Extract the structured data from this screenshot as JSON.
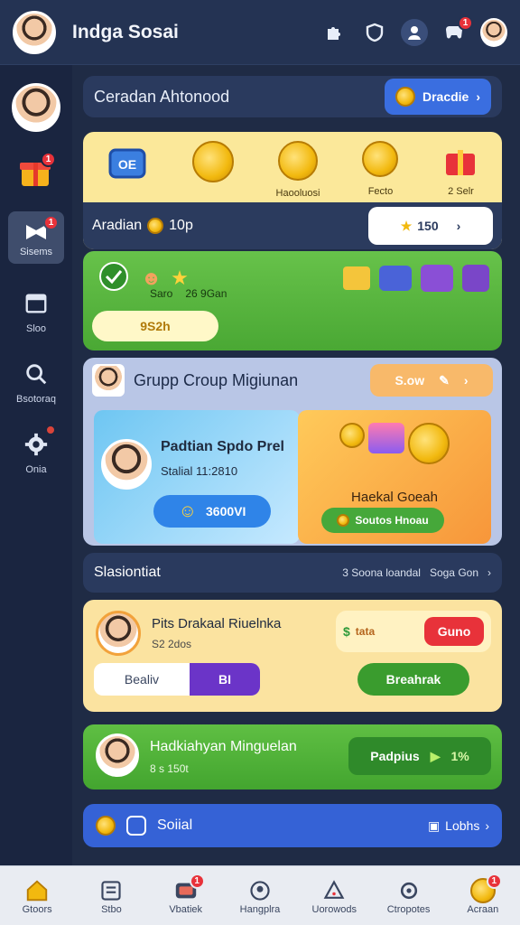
{
  "app": {
    "title": "Indga Sosai"
  },
  "topbar": {
    "notif_count": "1"
  },
  "sidebar": {
    "items": [
      {
        "label": "Sisems",
        "badge": "1"
      },
      {
        "label": "Sloo"
      },
      {
        "label": "Bsotoraq"
      },
      {
        "label": "Onia"
      }
    ]
  },
  "banner": {
    "title": "Ceradan Ahtonood",
    "button_label": "Dracdie"
  },
  "rewards": {
    "items": [
      {
        "label": ""
      },
      {
        "label": ""
      },
      {
        "label": "Haooluosi"
      },
      {
        "label": "Fecto"
      },
      {
        "label": "2 Selr"
      }
    ],
    "bottom_label": "Aradian",
    "bottom_value": "10p",
    "score": "150"
  },
  "green_card": {
    "left_a": "Saro",
    "left_b": "26 9Gan",
    "progress_label": "9S2h"
  },
  "group": {
    "title": "Grupp Croup Migiunan",
    "action_label": "S.ow",
    "promo1_title": "Padtian Spdo Prel",
    "promo1_sub": "Stalial 11:2810",
    "promo1_button": "3600VI",
    "promo2_title": "Haekal Goeah",
    "promo2_button": "Soutos Hnoau"
  },
  "section": {
    "title": "Slasiontiat",
    "right_a": "3 Soona loandal",
    "right_b": "Soga Gon"
  },
  "match": {
    "name": "Pits Drakaal Riuelnka",
    "sub": "S2 2dos",
    "chip_a": "tata",
    "chip_b": "Guno",
    "toggle_left": "Bealiv",
    "toggle_right": "BI",
    "action": "Breahrak"
  },
  "green_card2": {
    "title": "Hadkiahyan Minguelan",
    "sub": "8 s 150t",
    "button": "Padpius",
    "percent": "1%"
  },
  "social": {
    "label": "Soiial",
    "right": "Lobhs"
  },
  "navbar": {
    "items": [
      {
        "label": "Gtoors"
      },
      {
        "label": "Stbo"
      },
      {
        "label": "Vbatiek",
        "badge": "1"
      },
      {
        "label": "Hangplra"
      },
      {
        "label": "Uorowods"
      },
      {
        "label": "Ctropotes"
      },
      {
        "label": "Acraan",
        "badge": "1"
      }
    ]
  },
  "colors": {
    "accent_blue": "#3562d6",
    "green": "#4aa834",
    "yellow": "#fbe89a",
    "red": "#e8323a"
  }
}
